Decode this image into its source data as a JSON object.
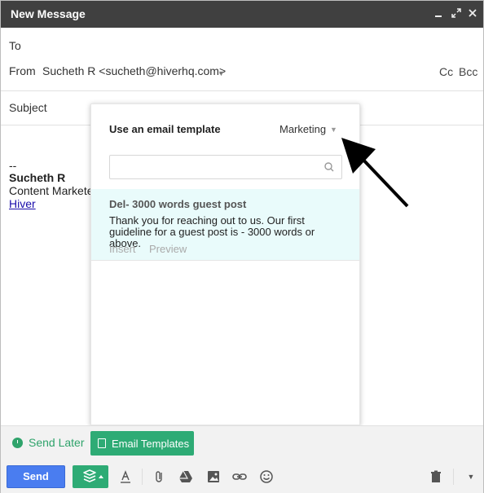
{
  "window": {
    "title": "New Message",
    "controls": [
      "minimize",
      "expand",
      "close"
    ]
  },
  "recipients": {
    "to_label": "To",
    "from_label": "From",
    "from_value": "Sucheth R <sucheth@hiverhq.com>",
    "cc_label": "Cc",
    "bcc_label": "Bcc",
    "subject_label": "Subject"
  },
  "body": {
    "sig_dashes": "--",
    "sig_name": "Sucheth R",
    "sig_title": "Content Marketer",
    "sig_link": "Hiver"
  },
  "template_popup": {
    "heading": "Use an email template",
    "category": "Marketing",
    "search_placeholder": "",
    "items": [
      {
        "title": "Del- 3000 words guest post",
        "description": "Thank you for reaching out to us. Our first guideline for a guest post is - 3000 words or above.",
        "insert_label": "Insert",
        "preview_label": "Preview"
      }
    ]
  },
  "hiver_bar": {
    "send_later_label": "Send Later",
    "email_templates_label": "Email Templates"
  },
  "toolbar": {
    "send_label": "Send",
    "icons": [
      "hiver-icon",
      "formatting-icon",
      "attach-icon",
      "drive-icon",
      "photo-icon",
      "link-icon",
      "emoji-icon",
      "trash-icon",
      "more-options-icon"
    ]
  },
  "colors": {
    "titlebar": "#404040",
    "hiver_green": "#2eab75",
    "send_blue": "#4a7df0",
    "highlight": "#e9fbfb",
    "link": "#1a0dab"
  }
}
